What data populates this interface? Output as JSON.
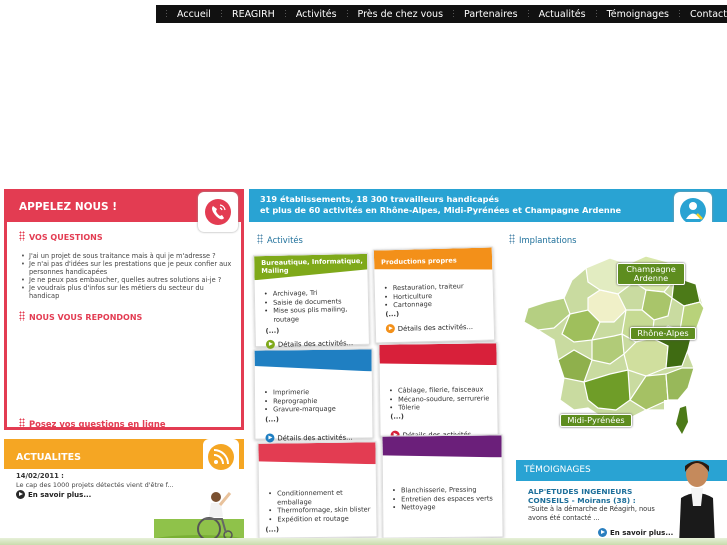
{
  "nav": {
    "items": [
      "Accueil",
      "REAGIRH",
      "Activités",
      "Près de chez vous",
      "Partenaires",
      "Actualités",
      "Témoignages",
      "Contact"
    ]
  },
  "appelez": {
    "title": "APPELEZ NOUS !",
    "vos_questions": "VOS QUESTIONS",
    "questions": [
      "J'ai un projet de sous traitance mais à qui je m'adresse ?",
      "Je n'ai pas d'idées sur les prestations que je peux confier aux personnes handicapées",
      "Je ne peux pas embaucher, quelles autres solutions ai-je ?",
      "Je voudrais plus d'infos sur les métiers du secteur du handicap"
    ],
    "nous_repondons": "NOUS VOUS REPONDONS",
    "posez": "Posez vos questions en ligne"
  },
  "actualites": {
    "title": "ACTUALITES",
    "date": "14/02/2011 :",
    "text": "Le cap des 1000 projets détectés vient d'être f...",
    "more": "En savoir plus..."
  },
  "banner": {
    "line1": "319 établissements, 18 300 travailleurs handicapés",
    "line2": "et plus de 60 activités en Rhône-Alpes, Midi-Pyrénées et Champagne Ardenne"
  },
  "activites": {
    "title": "Activités",
    "cards": [
      {
        "header": "Bureautique, Informatique, Mailing",
        "color": "#7fa91a",
        "items": [
          "Archivage, Tri",
          "Saisie de documents",
          "Mise sous plis mailing, routage"
        ],
        "ellipsis": "(...)",
        "details": "Détails des activités..."
      },
      {
        "header": "Productions propres",
        "color": "#f39019",
        "items": [
          "Restauration, traiteur",
          "Horticulture",
          "Cartonnage"
        ],
        "ellipsis": "(...)",
        "details": "Détails des activités..."
      },
      {
        "header": "",
        "color": "#1f7fc2",
        "items": [
          "Imprimerie",
          "Reprographie",
          "Gravure-marquage"
        ],
        "ellipsis": "(...)",
        "details": "Détails des activités..."
      },
      {
        "header": "",
        "color": "#d8203a",
        "items": [
          "Câblage, filerie, faisceaux",
          "Mécano-soudure, serrurerie",
          "Tôlerie"
        ],
        "ellipsis": "(...)",
        "details": "Détails des activités..."
      },
      {
        "header": "",
        "color": "#e33c52",
        "items": [
          "Conditionnement et emballage",
          "Thermoformage, skin blister",
          "Expédition et routage"
        ],
        "ellipsis": "(...)",
        "details": ""
      },
      {
        "header": "",
        "color": "#6b1f7a",
        "items": [
          "Blanchisserie, Pressing",
          "Entretien des espaces verts",
          "Nettoyage"
        ],
        "ellipsis": "(...)",
        "details": ""
      }
    ]
  },
  "implantations": {
    "title": "Implantations",
    "labels": [
      "Champagne Ardenne",
      "Rhône-Alpes",
      "Midi-Pyrénées"
    ]
  },
  "temoignages": {
    "title": "TÉMOIGNAGES",
    "company": "ALP'ETUDES INGENIEURS CONSEILS - Moirans (38) :",
    "quote": "\"Suite à la démarche de Réagirh, nous avons été contacté ...",
    "more": "En savoir plus..."
  },
  "colors": {
    "red": "#e33c52",
    "blue": "#29a3d3",
    "orange": "#f5a623",
    "green": "#5e8d1f"
  }
}
